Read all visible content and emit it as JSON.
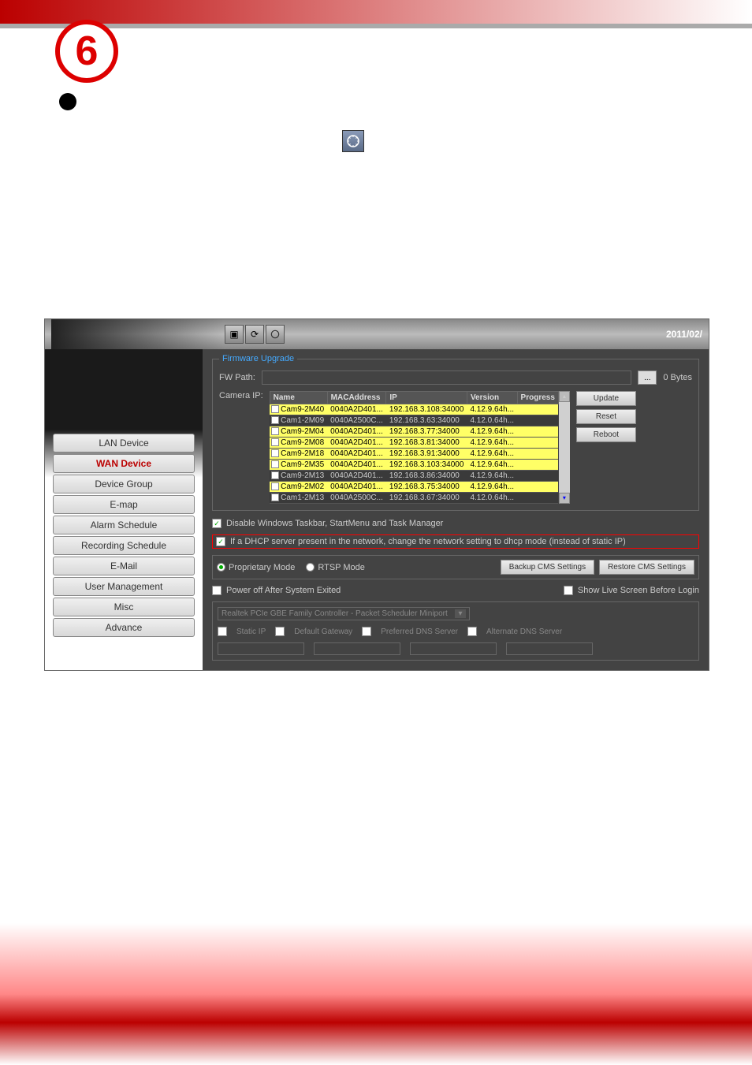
{
  "chapter_number": "6",
  "icon_name": "advance-icon",
  "titlebar": {
    "date": "2011/02/"
  },
  "sidebar": {
    "items": [
      {
        "label": "LAN Device"
      },
      {
        "label": "WAN Device"
      },
      {
        "label": "Device Group"
      },
      {
        "label": "E-map"
      },
      {
        "label": "Alarm Schedule"
      },
      {
        "label": "Recording Schedule"
      },
      {
        "label": "E-Mail"
      },
      {
        "label": "User Management"
      },
      {
        "label": "Misc"
      },
      {
        "label": "Advance"
      }
    ]
  },
  "firmware": {
    "legend": "Firmware Upgrade",
    "fw_path_label": "FW Path:",
    "size_text": "0 Bytes",
    "camera_ip_label": "Camera IP:",
    "columns": {
      "name": "Name",
      "mac": "MACAddress",
      "ip": "IP",
      "version": "Version",
      "progress": "Progress"
    },
    "rows": [
      {
        "name": "Cam9-2M40",
        "mac": "0040A2D401...",
        "ip": "192.168.3.108:34000",
        "version": "4.12.9.64h...",
        "hl": true
      },
      {
        "name": "Cam1-2M09",
        "mac": "0040A2500C...",
        "ip": "192.168.3.63:34000",
        "version": "4.12.0.64h...",
        "hl": false
      },
      {
        "name": "Cam9-2M04",
        "mac": "0040A2D401...",
        "ip": "192.168.3.77:34000",
        "version": "4.12.9.64h...",
        "hl": true
      },
      {
        "name": "Cam9-2M08",
        "mac": "0040A2D401...",
        "ip": "192.168.3.81:34000",
        "version": "4.12.9.64h...",
        "hl": true
      },
      {
        "name": "Cam9-2M18",
        "mac": "0040A2D401...",
        "ip": "192.168.3.91:34000",
        "version": "4.12.9.64h...",
        "hl": true
      },
      {
        "name": "Cam9-2M35",
        "mac": "0040A2D401...",
        "ip": "192.168.3.103:34000",
        "version": "4.12.9.64h...",
        "hl": true
      },
      {
        "name": "Cam9-2M13",
        "mac": "0040A2D401...",
        "ip": "192.168.3.86:34000",
        "version": "4.12.9.64h...",
        "hl": false
      },
      {
        "name": "Cam9-2M02",
        "mac": "0040A2D401...",
        "ip": "192.168.3.75:34000",
        "version": "4.12.9.64h...",
        "hl": true
      },
      {
        "name": "Cam1-2M13",
        "mac": "0040A2500C...",
        "ip": "192.168.3.67:34000",
        "version": "4.12.0.64h...",
        "hl": false
      }
    ],
    "buttons": {
      "update": "Update",
      "reset": "Reset",
      "reboot": "Reboot"
    }
  },
  "options": {
    "disable_taskbar": "Disable Windows Taskbar, StartMenu and Task Manager",
    "dhcp_note": "If a DHCP server present in the network, change the network setting to dhcp mode (instead of static IP)",
    "proprietary": "Proprietary Mode",
    "rtsp": "RTSP Mode",
    "backup": "Backup CMS Settings",
    "restore": "Restore CMS Settings",
    "power_off": "Power off After System Exited",
    "show_live": "Show Live Screen Before Login",
    "adapter": "Realtek PCIe GBE Family Controller - Packet Scheduler Miniport",
    "static_ip": "Static IP",
    "default_gw": "Default Gateway",
    "pref_dns": "Preferred DNS Server",
    "alt_dns": "Alternate DNS Server"
  }
}
